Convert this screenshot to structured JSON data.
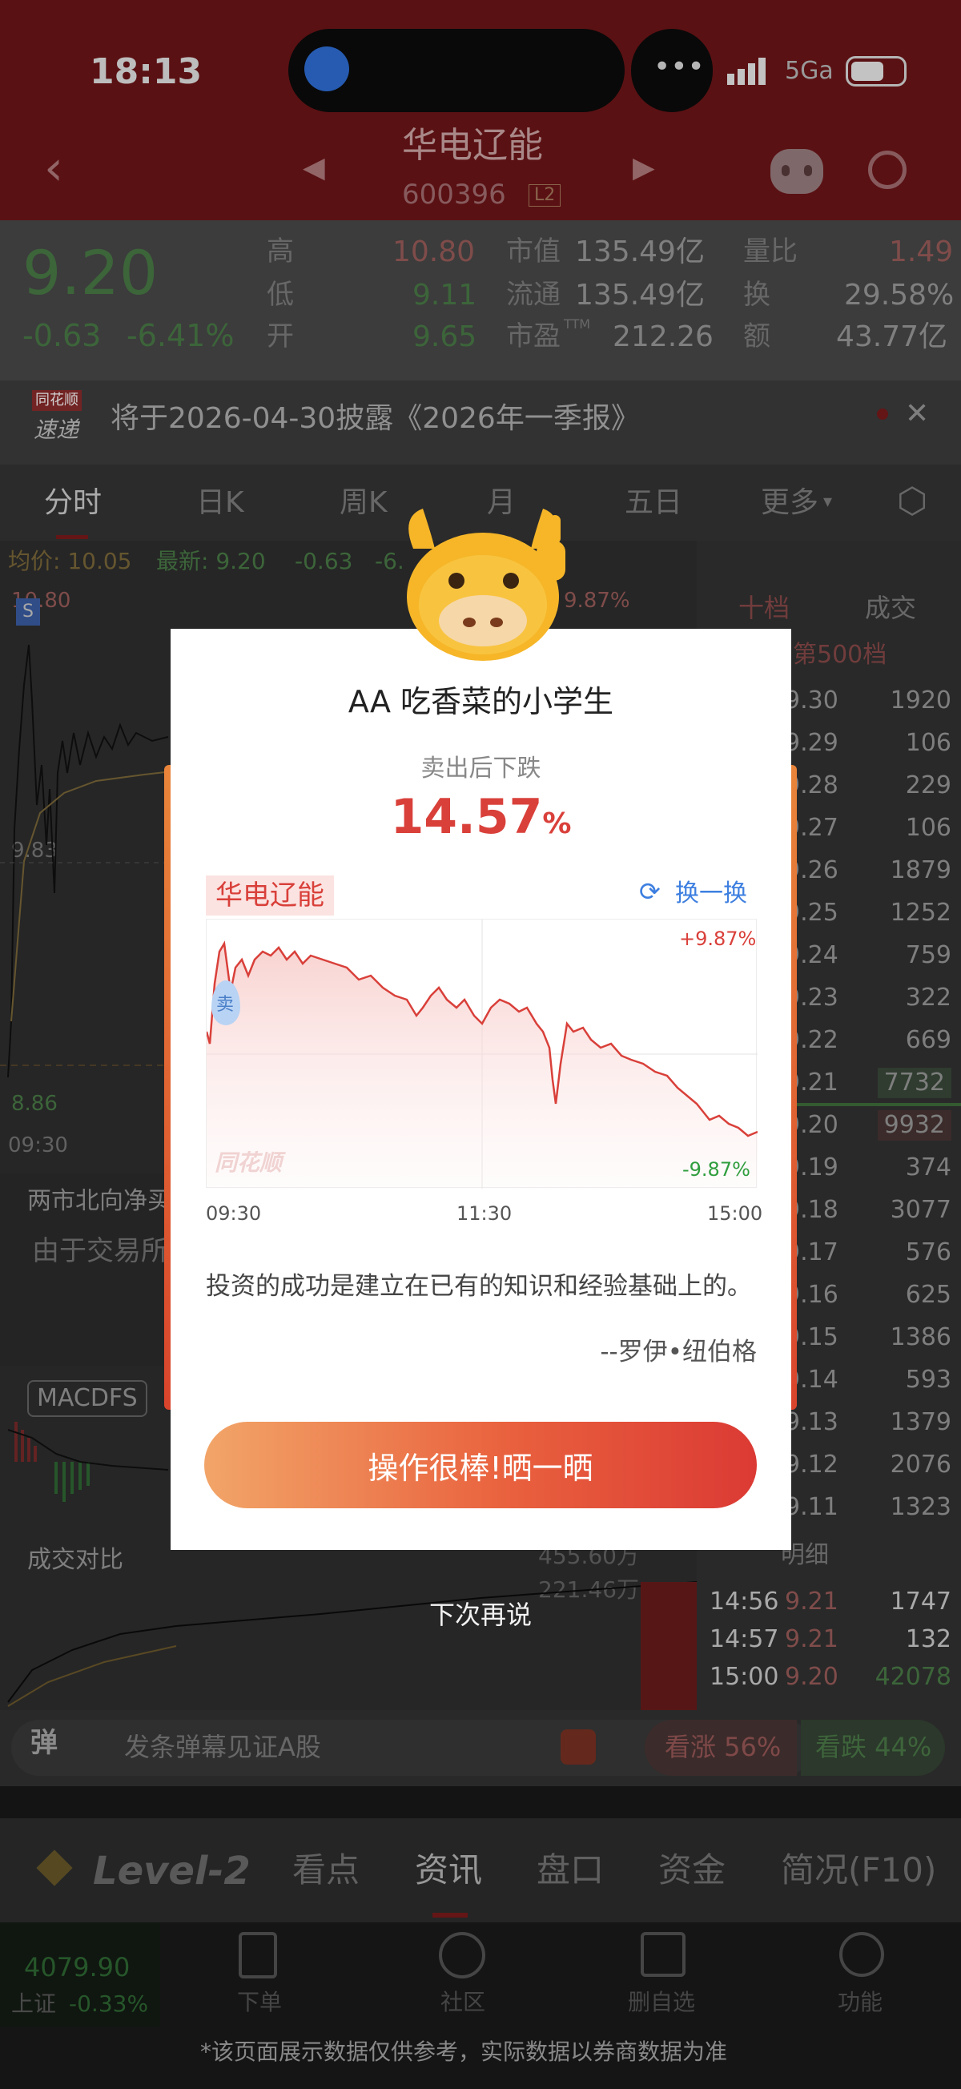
{
  "status_bar": {
    "time": "18:13",
    "network": "5Ga"
  },
  "nav": {
    "stock_name": "华电辽能",
    "stock_code": "600396",
    "level_badge": "L2"
  },
  "quote": {
    "price": "9.20",
    "change": "-0.63",
    "change_pct": "-6.41%",
    "high_label": "高",
    "high": "10.80",
    "low_label": "低",
    "low": "9.11",
    "open_label": "开",
    "open": "9.65",
    "mktcap_label": "市值",
    "mktcap": "135.49亿",
    "float_label": "流通",
    "float": "135.49亿",
    "pe_label": "市盈",
    "pe_sup": "TTM",
    "pe": "212.26",
    "vol_ratio_label": "量比",
    "vol_ratio": "1.49",
    "turnover_label": "换",
    "turnover": "29.58%",
    "amount_label": "额",
    "amount": "43.77亿"
  },
  "notice": {
    "badge_top": "同花顺",
    "badge_bottom": "速递",
    "text": "将于2026-04-30披露《2026年一季报》"
  },
  "tabs": [
    "分时",
    "日K",
    "周K",
    "月",
    "五日",
    "更多"
  ],
  "intraday": {
    "avg_label": "均价: 10.05",
    "latest_label": "最新: 9.20",
    "chg": "-0.63",
    "chg_pct_partial": "-6.",
    "y_top": "10.80",
    "y_mid": "9.83",
    "y_bottom": "8.86",
    "pct_top": "9.87%",
    "time_start": "09:30",
    "north_title": "两市北向净买",
    "north_msg": "由于交易所",
    "macd_label": "MACDFS",
    "vol_compare_label": "成交对比",
    "vol_val1": "455.60万",
    "vol_val2": "221.46万"
  },
  "order_book": {
    "tab_active": "十档",
    "tab_other": "成交",
    "link": "第500档",
    "rows": [
      {
        "price": "9.30",
        "vol": "1920"
      },
      {
        "price": "9.29",
        "vol": "106"
      },
      {
        "price": "9.28",
        "vol": "229"
      },
      {
        "price": "9.27",
        "vol": "106"
      },
      {
        "price": "9.26",
        "vol": "1879"
      },
      {
        "price": "9.25",
        "vol": "1252"
      },
      {
        "price": "9.24",
        "vol": "759"
      },
      {
        "price": "9.23",
        "vol": "322"
      },
      {
        "price": "9.22",
        "vol": "669"
      },
      {
        "price": "9.21",
        "vol": "7732"
      },
      {
        "price": "9.20",
        "vol": "9932"
      },
      {
        "price": "9.19",
        "vol": "374"
      },
      {
        "price": "9.18",
        "vol": "3077"
      },
      {
        "price": "9.17",
        "vol": "576"
      },
      {
        "price": "9.16",
        "vol": "625"
      },
      {
        "price": "9.15",
        "vol": "1386"
      },
      {
        "price": "9.14",
        "vol": "593"
      },
      {
        "price": "9.13",
        "vol": "1379"
      },
      {
        "price": "9.12",
        "vol": "2076"
      },
      {
        "price": "9.11",
        "vol": "1323"
      }
    ],
    "detail_label": "明细",
    "trades": [
      {
        "time": "14:56",
        "price": "9.21",
        "vol": "1747"
      },
      {
        "time": "14:57",
        "price": "9.21",
        "vol": "132"
      },
      {
        "time": "15:00",
        "price": "9.20",
        "vol": "42078"
      }
    ]
  },
  "danmaku": {
    "icon_text": "弹",
    "placeholder": "发条弹幕见证A股",
    "up_label": "看涨 56%",
    "down_label": "看跌 44%"
  },
  "bottom_tabs": [
    "Level-2",
    "看点",
    "资讯",
    "盘口",
    "资金",
    "简况(F10)"
  ],
  "footer": {
    "index_value": "4079.90",
    "index_name": "上证",
    "index_chg": "-0.33%",
    "actions": [
      "下单",
      "社区",
      "删自选",
      "功能"
    ],
    "disclaimer": "*该页面展示数据仅供参考，实际数据以券商数据为准"
  },
  "modal": {
    "username": "AA 吃香菜的小学生",
    "result_label": "卖出后下跌",
    "result_value": "14.57",
    "result_unit": "%",
    "stock_tag": "华电辽能",
    "refresh_label": "换一换",
    "pct_high": "+9.87%",
    "pct_low": "-9.87%",
    "sell_marker": "卖",
    "watermark": "同花顺",
    "time_labels": [
      "09:30",
      "11:30",
      "15:00"
    ],
    "quote": "投资的成功是建立在已有的知识和经验基础上的。",
    "author": "--罗伊•纽伯格",
    "share_button": "操作很棒!晒一晒",
    "dismiss": "下次再说"
  },
  "colors": {
    "up": "#d94a3d",
    "down": "#2f9e3e",
    "brand": "#7a1a1c",
    "modal_accent": "#d9403a",
    "link_blue": "#3d7fe0"
  }
}
